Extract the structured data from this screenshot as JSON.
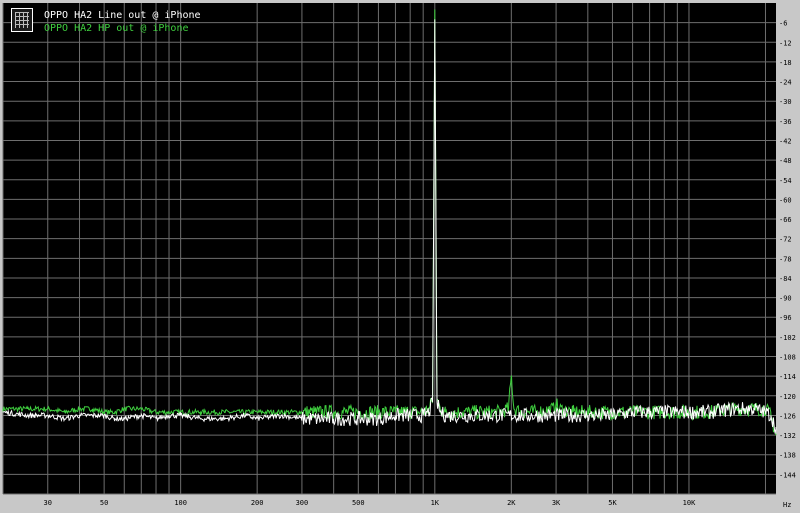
{
  "chart_data": {
    "type": "line",
    "xscale": "log",
    "xlim": [
      20,
      22000
    ],
    "ylim": [
      -150,
      0
    ],
    "grid": true,
    "legend_placement": "top-left",
    "x_ticks": [
      {
        "v": 30,
        "label": "30"
      },
      {
        "v": 50,
        "label": "50"
      },
      {
        "v": 100,
        "label": "100"
      },
      {
        "v": 200,
        "label": "200"
      },
      {
        "v": 300,
        "label": "300"
      },
      {
        "v": 500,
        "label": "500"
      },
      {
        "v": 1000,
        "label": "1K"
      },
      {
        "v": 2000,
        "label": "2K"
      },
      {
        "v": 3000,
        "label": "3K"
      },
      {
        "v": 5000,
        "label": "5K"
      },
      {
        "v": 10000,
        "label": "10K"
      }
    ],
    "x_unit": "Hz",
    "y_ticks": [
      -6,
      -12,
      -18,
      -24,
      -30,
      -36,
      -42,
      -48,
      -54,
      -60,
      -66,
      -72,
      -78,
      -84,
      -90,
      -96,
      -102,
      -108,
      -114,
      -120,
      -126,
      -132,
      -138,
      -144
    ],
    "series": [
      {
        "name": "OPPO HA2 Line out @ iPhone",
        "color": "#ffffff",
        "x": [
          20,
          25,
          30,
          35,
          40,
          45,
          50,
          55,
          60,
          70,
          80,
          90,
          100,
          120,
          150,
          180,
          200,
          250,
          300,
          350,
          400,
          500,
          600,
          700,
          800,
          900,
          950,
          980,
          1000,
          1020,
          1050,
          1100,
          1200,
          1500,
          1800,
          2000,
          2200,
          2500,
          3000,
          3500,
          4000,
          5000,
          6000,
          7000,
          8000,
          10000,
          12000,
          15000,
          18000,
          20000,
          21000,
          22000
        ],
        "y": [
          -125,
          -126,
          -126,
          -127,
          -126,
          -126,
          -126,
          -127,
          -127,
          -126,
          -127,
          -126,
          -126,
          -127,
          -127,
          -126,
          -127,
          -126,
          -127,
          -127,
          -127,
          -127,
          -127,
          -126,
          -126,
          -126,
          -125,
          -122,
          -5,
          -122,
          -125,
          -126,
          -126,
          -126,
          -126,
          -126,
          -126,
          -126,
          -126,
          -126,
          -126,
          -126,
          -125,
          -125,
          -125,
          -125,
          -125,
          -124,
          -124,
          -125,
          -126,
          -130
        ]
      },
      {
        "name": "OPPO HA2 HP out @ iPhone",
        "color": "#3fcf3f",
        "x": [
          20,
          25,
          30,
          35,
          40,
          45,
          50,
          55,
          60,
          70,
          80,
          90,
          100,
          120,
          150,
          180,
          200,
          250,
          300,
          350,
          400,
          500,
          600,
          700,
          800,
          900,
          950,
          980,
          1000,
          1020,
          1050,
          1100,
          1200,
          1500,
          1800,
          1950,
          2000,
          2050,
          2200,
          2500,
          2950,
          3000,
          3050,
          3500,
          4000,
          5000,
          6000,
          7000,
          8000,
          10000,
          12000,
          15000,
          18000,
          20000,
          21000,
          22000
        ],
        "y": [
          -124,
          -124,
          -124,
          -125,
          -124,
          -124,
          -125,
          -125,
          -124,
          -124,
          -125,
          -125,
          -125,
          -125,
          -125,
          -125,
          -125,
          -125,
          -125,
          -125,
          -125,
          -125,
          -125,
          -125,
          -125,
          -125,
          -124,
          -121,
          -2,
          -121,
          -124,
          -125,
          -125,
          -125,
          -125,
          -124,
          -114,
          -124,
          -125,
          -125,
          -124,
          -122,
          -124,
          -125,
          -125,
          -125,
          -125,
          -125,
          -125,
          -125,
          -125,
          -124,
          -124,
          -124,
          -126,
          -132
        ]
      }
    ]
  }
}
